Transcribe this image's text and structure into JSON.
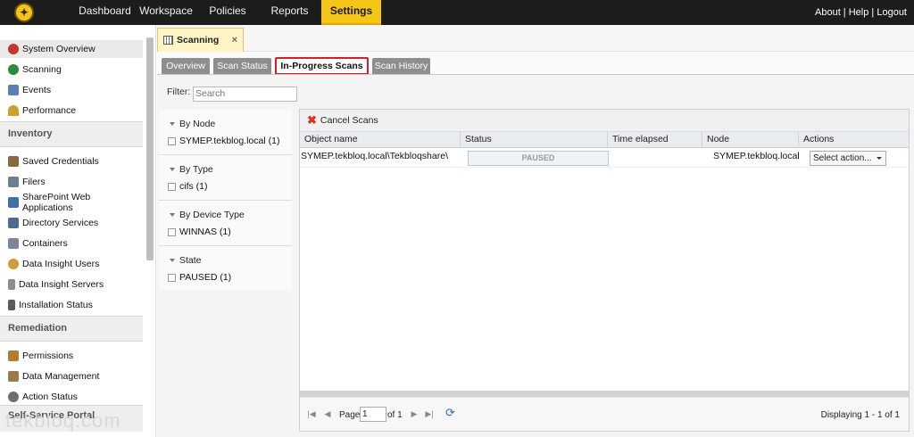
{
  "topnav": {
    "items": [
      {
        "label": "Dashboard"
      },
      {
        "label": "Workspace"
      },
      {
        "label": "Policies"
      },
      {
        "label": "Reports"
      },
      {
        "label": "Settings"
      }
    ],
    "links": {
      "about": "About",
      "sep1": " | ",
      "help": "Help",
      "sep2": " | ",
      "logout": "Logout"
    },
    "active_color": "#f5c518"
  },
  "sidebar": {
    "items": [
      {
        "label": "System Overview",
        "icon": "system-overview-icon"
      },
      {
        "label": "Scanning",
        "icon": "scanning-icon"
      },
      {
        "label": "Events",
        "icon": "events-icon"
      },
      {
        "label": "Performance",
        "icon": "performance-icon"
      }
    ],
    "section_inventory": "Inventory",
    "inventory_items": [
      {
        "label": "Saved Credentials",
        "icon": "credentials-icon"
      },
      {
        "label": "Filers",
        "icon": "filers-icon"
      },
      {
        "label": "SharePoint Web Applications",
        "icon": "sharepoint-icon"
      },
      {
        "label": "Directory Services",
        "icon": "directory-icon"
      },
      {
        "label": "Containers",
        "icon": "containers-icon"
      },
      {
        "label": "Data Insight Users",
        "icon": "users-icon"
      },
      {
        "label": "Data Insight Servers",
        "icon": "servers-icon"
      },
      {
        "label": "Installation Status",
        "icon": "installation-icon"
      }
    ],
    "section_remediation": "Remediation",
    "remediation_items": [
      {
        "label": "Permissions",
        "icon": "permissions-icon"
      },
      {
        "label": "Data Management",
        "icon": "data-management-icon"
      },
      {
        "label": "Action Status",
        "icon": "action-status-icon"
      }
    ],
    "section_selfservice": "Self-Service Portal"
  },
  "doc_tab": {
    "label": "Scanning",
    "close": "×"
  },
  "subtabs": [
    {
      "label": "Overview"
    },
    {
      "label": "Scan Status"
    },
    {
      "label": "In-Progress Scans"
    },
    {
      "label": "Scan History"
    }
  ],
  "filter": {
    "label": "Filter:",
    "placeholder": "Search"
  },
  "facets": [
    {
      "title": "By Node",
      "value": "SYMEP.tekblog.local (1)"
    },
    {
      "title": "By Type",
      "value": "cifs (1)"
    },
    {
      "title": "By Device Type",
      "value": "WINNAS (1)"
    },
    {
      "title": "State",
      "value": "PAUSED (1)"
    }
  ],
  "grid": {
    "toolbar": {
      "cancel_label": "Cancel Scans"
    },
    "columns": [
      "Object name",
      "Status",
      "Time elapsed",
      "Node",
      "Actions"
    ],
    "rows": [
      {
        "object_name": "SYMEP.tekbloq.local\\Tekbloqshare\\",
        "status": "PAUSED",
        "time_elapsed": "",
        "node": "SYMEP.tekbloq.local",
        "action": "Select action..."
      }
    ]
  },
  "pager": {
    "page_label": "Page",
    "page_value": "1",
    "of_label": "of 1",
    "display": "Displaying 1 - 1 of 1"
  },
  "watermark": "tekbloq.com"
}
